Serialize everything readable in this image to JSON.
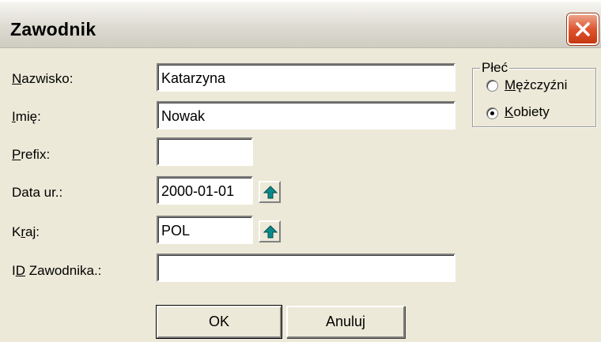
{
  "window": {
    "title": "Zawodnik"
  },
  "form": {
    "surname": {
      "label_mnemonic": "N",
      "label_rest": "azwisko:",
      "value": "Katarzyna"
    },
    "first_name": {
      "label_mnemonic": "I",
      "label_rest": "mię:",
      "value": "Nowak"
    },
    "prefix": {
      "label_mnemonic": "P",
      "label_rest": "refix:",
      "value": ""
    },
    "birth_date": {
      "label": "Data ur.:",
      "value": "2000-01-01"
    },
    "country": {
      "label_pre": "K",
      "label_mnemonic": "r",
      "label_rest": "aj:",
      "value": "POL"
    },
    "athlete_id": {
      "label_pre": "I",
      "label_mnemonic": "D",
      "label_rest": " Zawodnika.:",
      "value": ""
    }
  },
  "gender": {
    "title": "Płeć",
    "options": [
      {
        "pre": "",
        "mnemonic": "M",
        "rest": "ężczyźni",
        "selected": false
      },
      {
        "pre": "",
        "mnemonic": "K",
        "rest": "obiety",
        "selected": true
      }
    ]
  },
  "buttons": {
    "ok": "OK",
    "cancel": "Anuluj"
  },
  "icons": {
    "close": "close-icon",
    "arrow": "arrow-up-icon"
  },
  "colors": {
    "arrow_fill": "#0a8a8a",
    "close_bg": "#de5530"
  }
}
